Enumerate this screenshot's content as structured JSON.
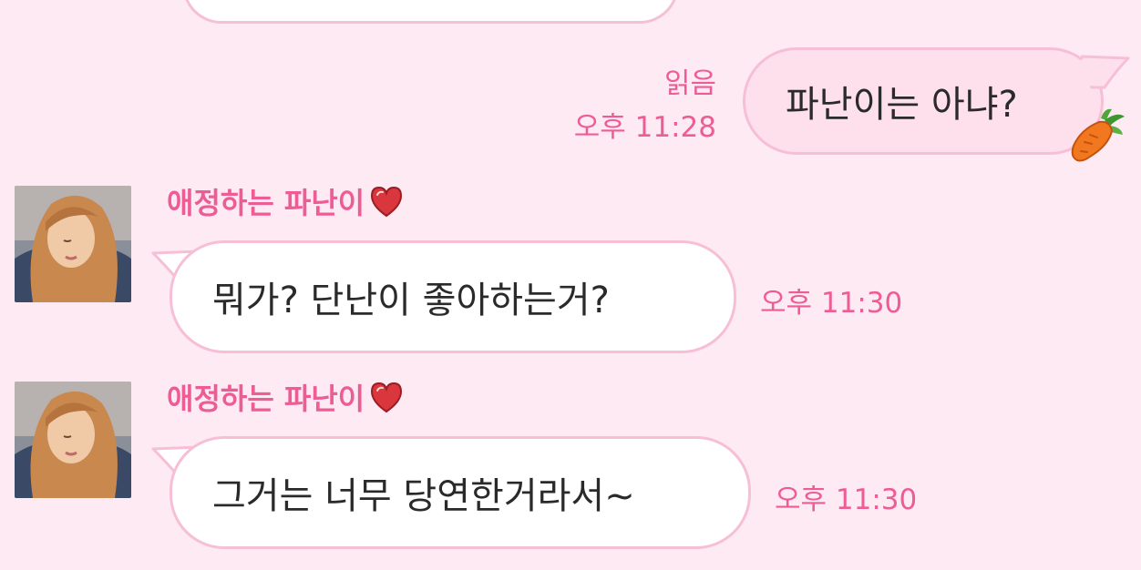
{
  "chat": {
    "messages": [
      {
        "side": "outgoing",
        "text": "파난이는 아냐?",
        "read_label": "읽음",
        "time": "오후 11:28",
        "sticker_icon": "carrot-icon"
      },
      {
        "side": "incoming",
        "sender": "애정하는 파난이",
        "sender_icon": "heart-icon",
        "text": "뭐가? 단난이 좋아하는거?",
        "time": "오후 11:30"
      },
      {
        "side": "incoming",
        "sender": "애정하는 파난이",
        "sender_icon": "heart-icon",
        "text": "그거는 너무 당연한거라서~",
        "time": "오후 11:30"
      }
    ]
  },
  "colors": {
    "background": "#fdeaf3",
    "accent": "#ee5c95",
    "bubble_border": "#f6bfd6",
    "incoming_bubble": "#ffffff",
    "outgoing_bubble": "#fde0ec"
  }
}
